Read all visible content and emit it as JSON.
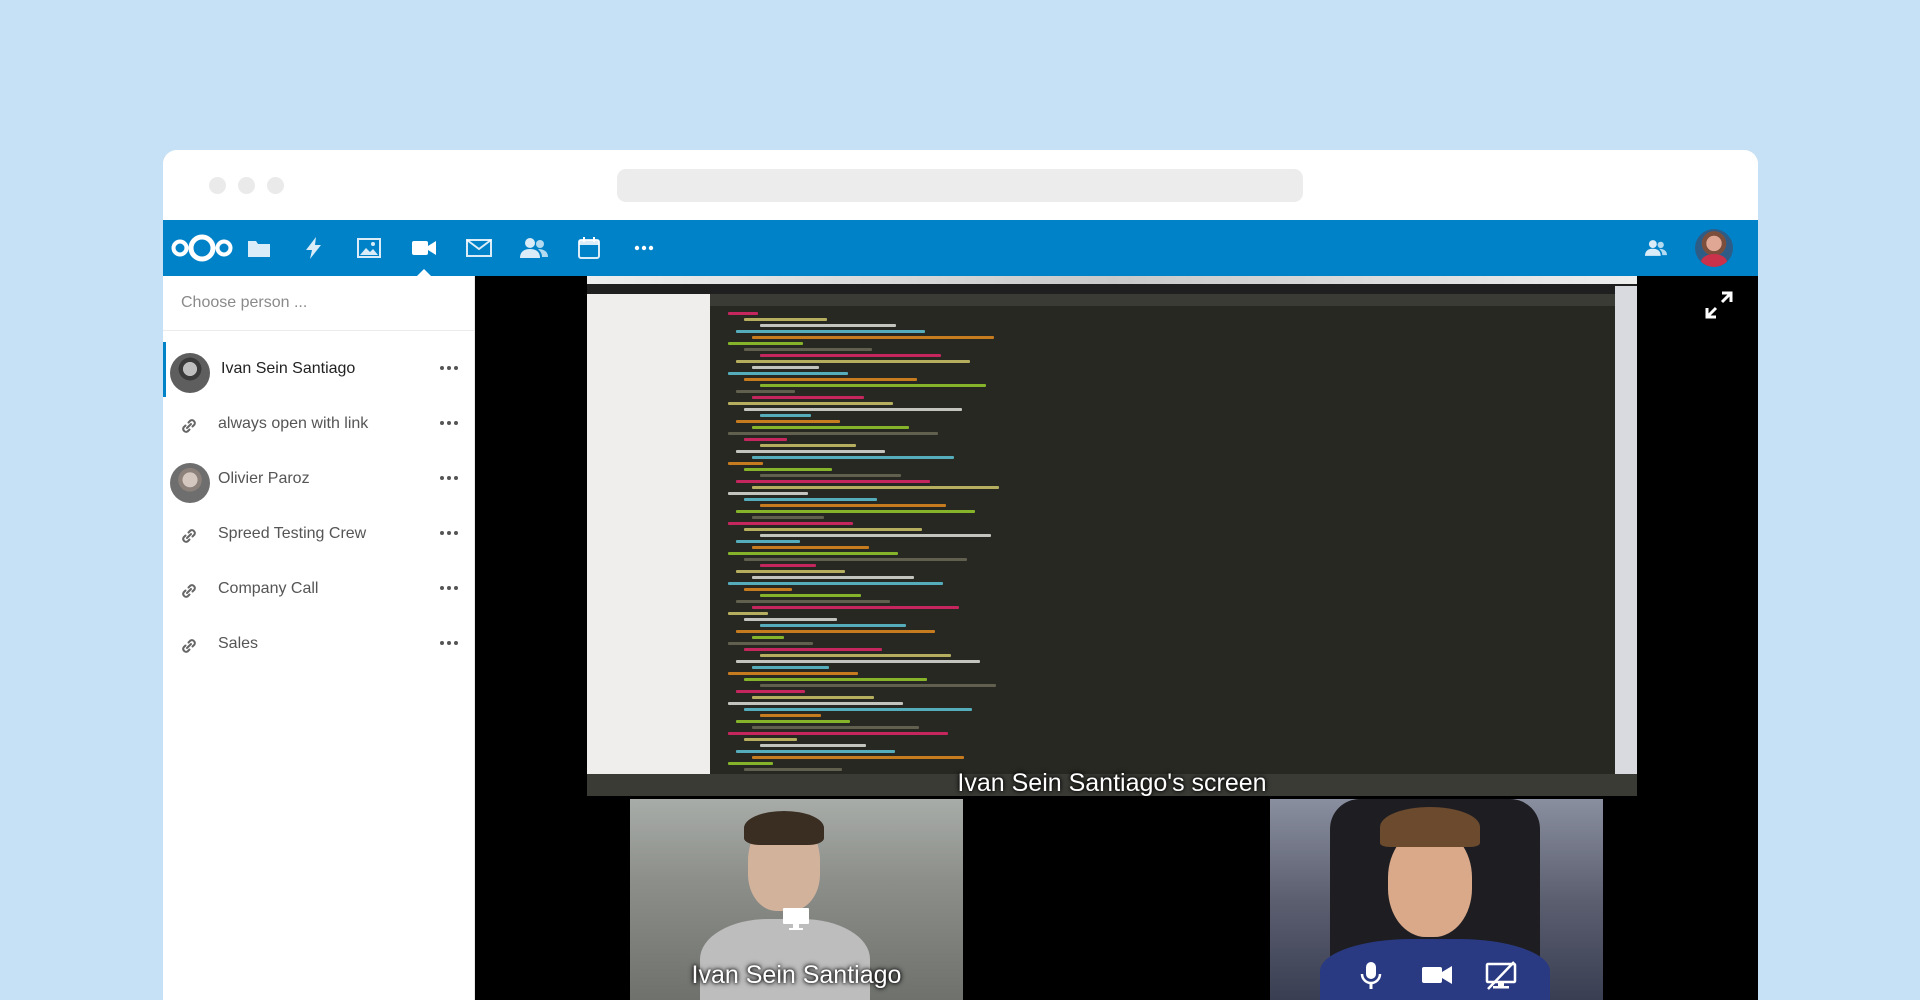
{
  "browser": {
    "url": ""
  },
  "nav": {
    "apps": [
      {
        "icon": "nextcloud-logo-icon"
      },
      {
        "icon": "files-folder-icon"
      },
      {
        "icon": "activity-bolt-icon"
      },
      {
        "icon": "gallery-image-icon"
      },
      {
        "icon": "talk-video-icon",
        "active": true
      },
      {
        "icon": "mail-icon"
      },
      {
        "icon": "contacts-icon"
      },
      {
        "icon": "calendar-icon"
      },
      {
        "icon": "more-apps-icon"
      }
    ],
    "right": [
      "contacts-menu-icon",
      "user-avatar"
    ],
    "accent": "#0082c9"
  },
  "sidebar": {
    "search_placeholder": "Choose person ...",
    "items": [
      {
        "label": "Ivan Sein Santiago",
        "type": "user",
        "active": true
      },
      {
        "label": "always open with link",
        "type": "link"
      },
      {
        "label": "Olivier Paroz",
        "type": "user"
      },
      {
        "label": "Spreed Testing Crew",
        "type": "link"
      },
      {
        "label": "Company Call",
        "type": "link"
      },
      {
        "label": "Sales",
        "type": "link"
      }
    ]
  },
  "call": {
    "screen_share_label": "Ivan Sein Santiago's screen",
    "participants": [
      {
        "name": "Ivan Sein Santiago",
        "icon": "screen-share-icon"
      },
      {
        "name": "",
        "controls": [
          "microphone-icon",
          "camera-icon",
          "screen-share-off-icon"
        ]
      }
    ]
  }
}
